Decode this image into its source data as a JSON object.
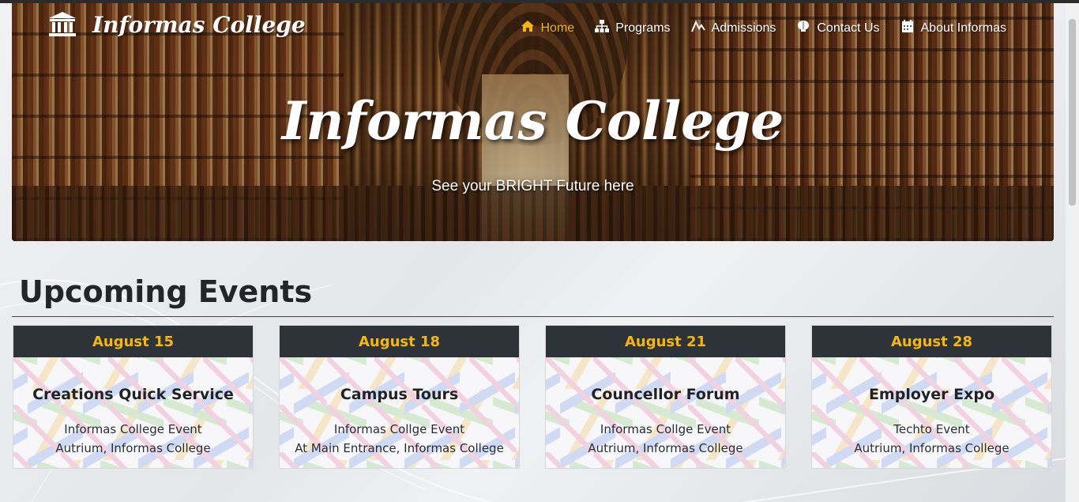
{
  "brand": {
    "name": "Informas College",
    "icon": "building-columns-icon"
  },
  "nav": {
    "items": [
      {
        "label": "Home",
        "icon": "home-icon",
        "active": true
      },
      {
        "label": "Programs",
        "icon": "sitemap-icon",
        "active": false
      },
      {
        "label": "Admissions",
        "icon": "chart-line-icon",
        "active": false
      },
      {
        "label": "Contact Us",
        "icon": "brain-icon",
        "active": false
      },
      {
        "label": "About Informas",
        "icon": "calendar-icon",
        "active": false
      }
    ]
  },
  "hero": {
    "title": "Informas College",
    "subtitle": "See your BRIGHT Future here"
  },
  "events": {
    "heading": "Upcoming Events",
    "items": [
      {
        "date": "August 15",
        "title": "Creations Quick Service",
        "line1": "Informas College Event",
        "line2": "Autrium, Informas College"
      },
      {
        "date": "August 18",
        "title": "Campus Tours",
        "line1": "Informas Collge Event",
        "line2": "At Main Entrance, Informas College"
      },
      {
        "date": "August 21",
        "title": "Councellor Forum",
        "line1": "Informas Collge Event",
        "line2": "Autrium, Informas College"
      },
      {
        "date": "August 28",
        "title": "Employer Expo",
        "line1": "Techto Event",
        "line2": "Autrium, Informas College"
      }
    ]
  },
  "colors": {
    "accent": "#f5b70f",
    "card_header": "#2e333a",
    "heading_text": "#22252a"
  }
}
